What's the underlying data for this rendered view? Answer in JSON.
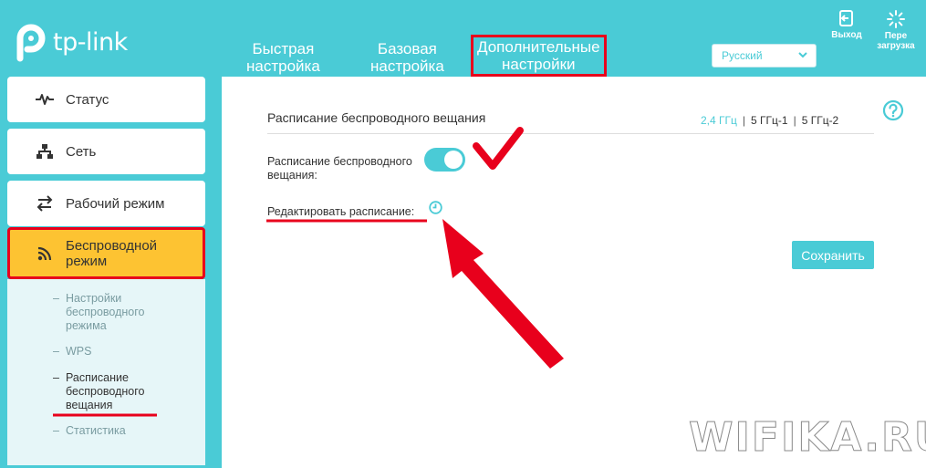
{
  "brand": {
    "logo_text": "tp-link"
  },
  "header": {
    "tabs": [
      {
        "line1": "Быстрая",
        "line2": "настройка"
      },
      {
        "line1": "Базовая",
        "line2": "настройка"
      },
      {
        "line1": "Дополнительные",
        "line2": "настройки"
      }
    ],
    "language": "Русский",
    "logout_label": "Выход",
    "reboot_line1": "Пере",
    "reboot_line2": "загрузка"
  },
  "sidebar": {
    "items": [
      {
        "label": "Статус",
        "icon": "pulse-icon"
      },
      {
        "label": "Сеть",
        "icon": "network-icon"
      },
      {
        "label": "Рабочий режим",
        "icon": "swap-icon"
      },
      {
        "line1": "Беспроводной",
        "line2": "режим",
        "icon": "wifi-icon"
      }
    ],
    "submenu": [
      {
        "lines": [
          "Настройки",
          "беспроводного",
          "режима"
        ]
      },
      {
        "lines": [
          "WPS"
        ]
      },
      {
        "lines": [
          "Расписание",
          "беспроводного",
          "вещания"
        ]
      },
      {
        "lines": [
          "Статистика"
        ]
      }
    ]
  },
  "main": {
    "title": "Расписание беспроводного вещания",
    "bands": [
      "2,4 ГГц",
      "5 ГГц-1",
      "5 ГГц-2"
    ],
    "schedule_label_line1": "Расписание беспроводного",
    "schedule_label_line2": "вещания:",
    "schedule_enabled": true,
    "edit_label": "Редактировать расписание:",
    "save_label": "Сохранить"
  },
  "watermark": "WIFIKA.RU",
  "colors": {
    "accent": "#4acbd6",
    "active_menu": "#fdc332",
    "annotation": "#e8001c"
  }
}
